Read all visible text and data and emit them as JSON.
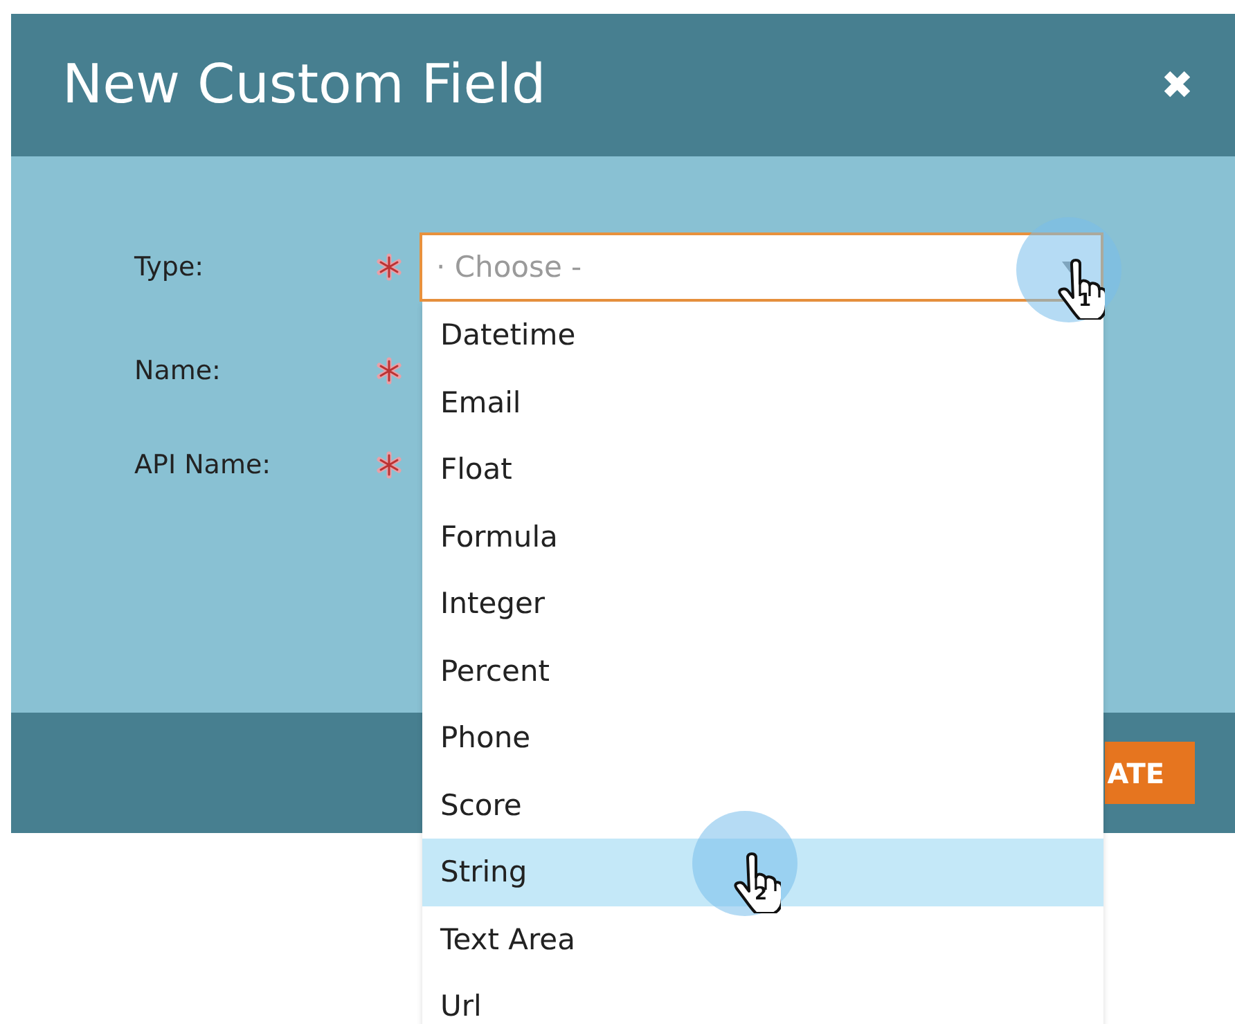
{
  "dialog": {
    "title": "New Custom Field",
    "close_label": "✖"
  },
  "fields": [
    {
      "label": "Type:",
      "required": true
    },
    {
      "label": "Name:",
      "required": true
    },
    {
      "label": "API Name:",
      "required": true
    }
  ],
  "type_select": {
    "placeholder": "· Choose -",
    "open": true
  },
  "options": [
    {
      "label": "Datetime",
      "selected": false
    },
    {
      "label": "Email",
      "selected": false
    },
    {
      "label": "Float",
      "selected": false
    },
    {
      "label": "Formula",
      "selected": false
    },
    {
      "label": "Integer",
      "selected": false
    },
    {
      "label": "Percent",
      "selected": false
    },
    {
      "label": "Phone",
      "selected": false
    },
    {
      "label": "Score",
      "selected": false
    },
    {
      "label": "String",
      "selected": true
    },
    {
      "label": "Text Area",
      "selected": false
    },
    {
      "label": "Url",
      "selected": false
    }
  ],
  "footer": {
    "button_label": "ATE"
  },
  "callouts": [
    {
      "number": "1"
    },
    {
      "number": "2"
    }
  ]
}
